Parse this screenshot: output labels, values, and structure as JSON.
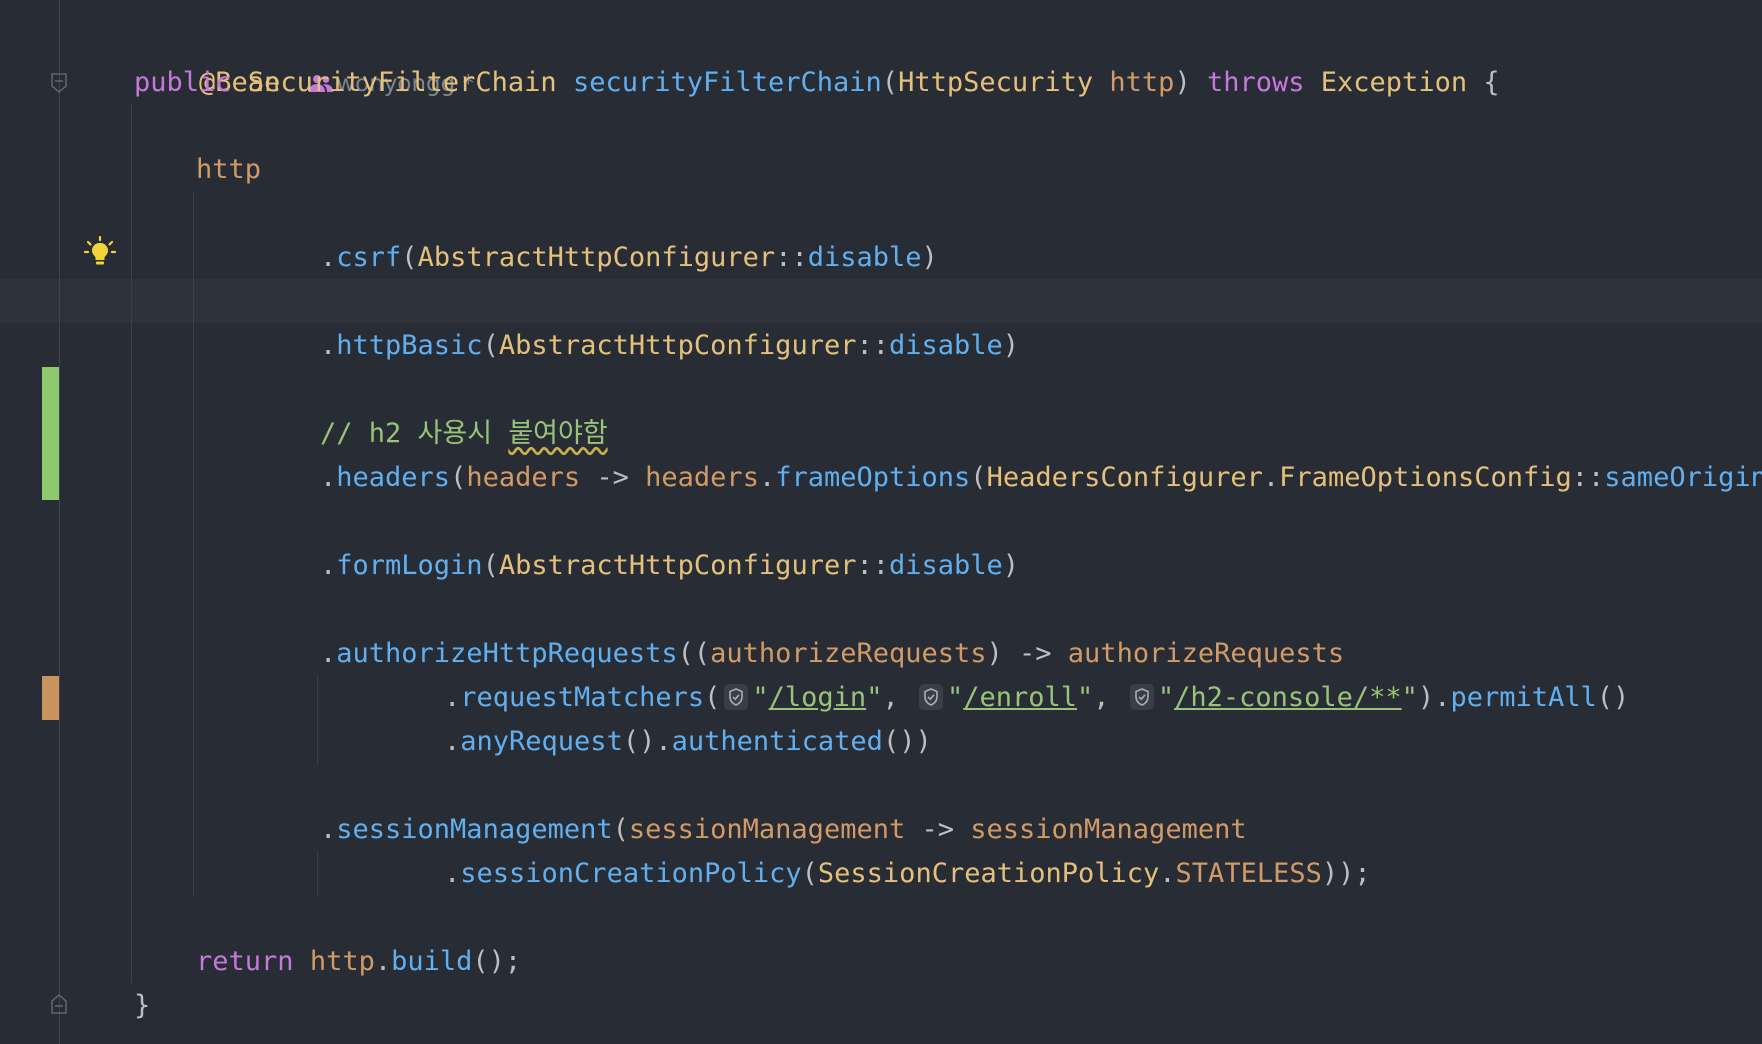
{
  "annotation": "@Bean",
  "author": {
    "name": "wonyongg *",
    "icon": "people-icon"
  },
  "lines": {
    "signature": {
      "kw": "public",
      "ret": "SecurityFilterChain",
      "fn": "securityFilterChain",
      "open": "(",
      "ptype": "HttpSecurity",
      "pname": "http",
      "close": ")",
      "throws": "throws",
      "exc": "Exception",
      "brace": "{"
    },
    "http": "http",
    "csrf": {
      "dot": ".",
      "fn": "csrf",
      "open": "(",
      "cls": "AbstractHttpConfigurer",
      "sep": "::",
      "ref": "disable",
      "close": ")"
    },
    "httpBasic": {
      "dot": ".",
      "fn": "httpBasic",
      "open": "(",
      "cls": "AbstractHttpConfigurer",
      "sep": "::",
      "ref": "disable",
      "close": ")"
    },
    "comment": {
      "prefix": "// h2 사용시 ",
      "squiggled": "붙여야함"
    },
    "headers": {
      "dot": ".",
      "fn": "headers",
      "open": "(",
      "param": "headers",
      "arrow": " -> ",
      "recv": "headers",
      "dot2": ".",
      "fn2": "frameOptions",
      "open2": "(",
      "cls": "HeadersConfigurer",
      "dot3": ".",
      "cls2": "FrameOptionsConfig",
      "sep": "::",
      "ref": "sameOrigin",
      "close": "))"
    },
    "formLogin": {
      "dot": ".",
      "fn": "formLogin",
      "open": "(",
      "cls": "AbstractHttpConfigurer",
      "sep": "::",
      "ref": "disable",
      "close": ")"
    },
    "authorize": {
      "dot": ".",
      "fn": "authorizeHttpRequests",
      "open": "((",
      "param": "authorizeRequests",
      "close": ")",
      "arrow": " -> ",
      "recv": "authorizeRequests"
    },
    "requestMatchers": {
      "dot": ".",
      "fn": "requestMatchers",
      "open": "(",
      "q": "\"",
      "url1": "/login",
      "comma": ", ",
      "url2": "/enroll",
      "url3": "/h2-console/**",
      "close": ")",
      "dot2": ".",
      "fn2": "permitAll",
      "parens": "()"
    },
    "anyRequest": {
      "dot": ".",
      "fn": "anyRequest",
      "parens": "()",
      "dot2": ".",
      "fn2": "authenticated",
      "close": "())"
    },
    "session": {
      "dot": ".",
      "fn": "sessionManagement",
      "open": "(",
      "param": "sessionManagement",
      "arrow": " -> ",
      "recv": "sessionManagement"
    },
    "policy": {
      "dot": ".",
      "fn": "sessionCreationPolicy",
      "open": "(",
      "cls": "SessionCreationPolicy",
      "dot2": ".",
      "const": "STATELESS",
      "close": "));"
    },
    "ret": {
      "kw": "return",
      "recv": "http",
      "dot": ".",
      "fn": "build",
      "close": "();"
    },
    "closeBrace": "}"
  },
  "gutter": {
    "bulb_icon": "lightbulb-icon",
    "shield_icon": "shield-icon"
  },
  "colors": {
    "background": "#282c34",
    "keyword": "#c678dd",
    "type": "#e5c07b",
    "function": "#61afef",
    "param": "#d19a66",
    "string": "#98c379",
    "added": "#8fc96d",
    "modified": "#c8935d"
  }
}
